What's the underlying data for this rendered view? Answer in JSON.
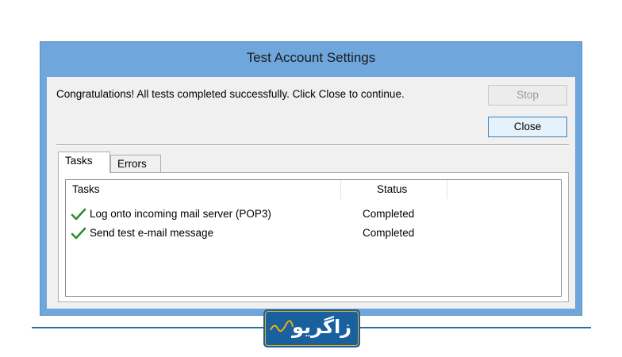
{
  "dialog": {
    "title": "Test Account Settings",
    "message": "Congratulations! All tests completed successfully. Click Close to continue.",
    "buttons": {
      "stop": "Stop",
      "close": "Close"
    },
    "tabs": [
      {
        "label": "Tasks",
        "selected": true
      },
      {
        "label": "Errors",
        "selected": false
      }
    ],
    "columns": {
      "tasks": "Tasks",
      "status": "Status"
    },
    "rows": [
      {
        "task": "Log onto incoming mail server (POP3)",
        "status": "Completed",
        "icon": "check-icon"
      },
      {
        "task": "Send test e-mail message",
        "status": "Completed",
        "icon": "check-icon"
      }
    ]
  },
  "branding": {
    "logo_text": "زاگریو"
  },
  "colors": {
    "title_bar": "#6fa6dc",
    "check": "#2e8b2e",
    "logo_bg": "#1a5f9e",
    "accent_line": "#2a6fa0"
  }
}
